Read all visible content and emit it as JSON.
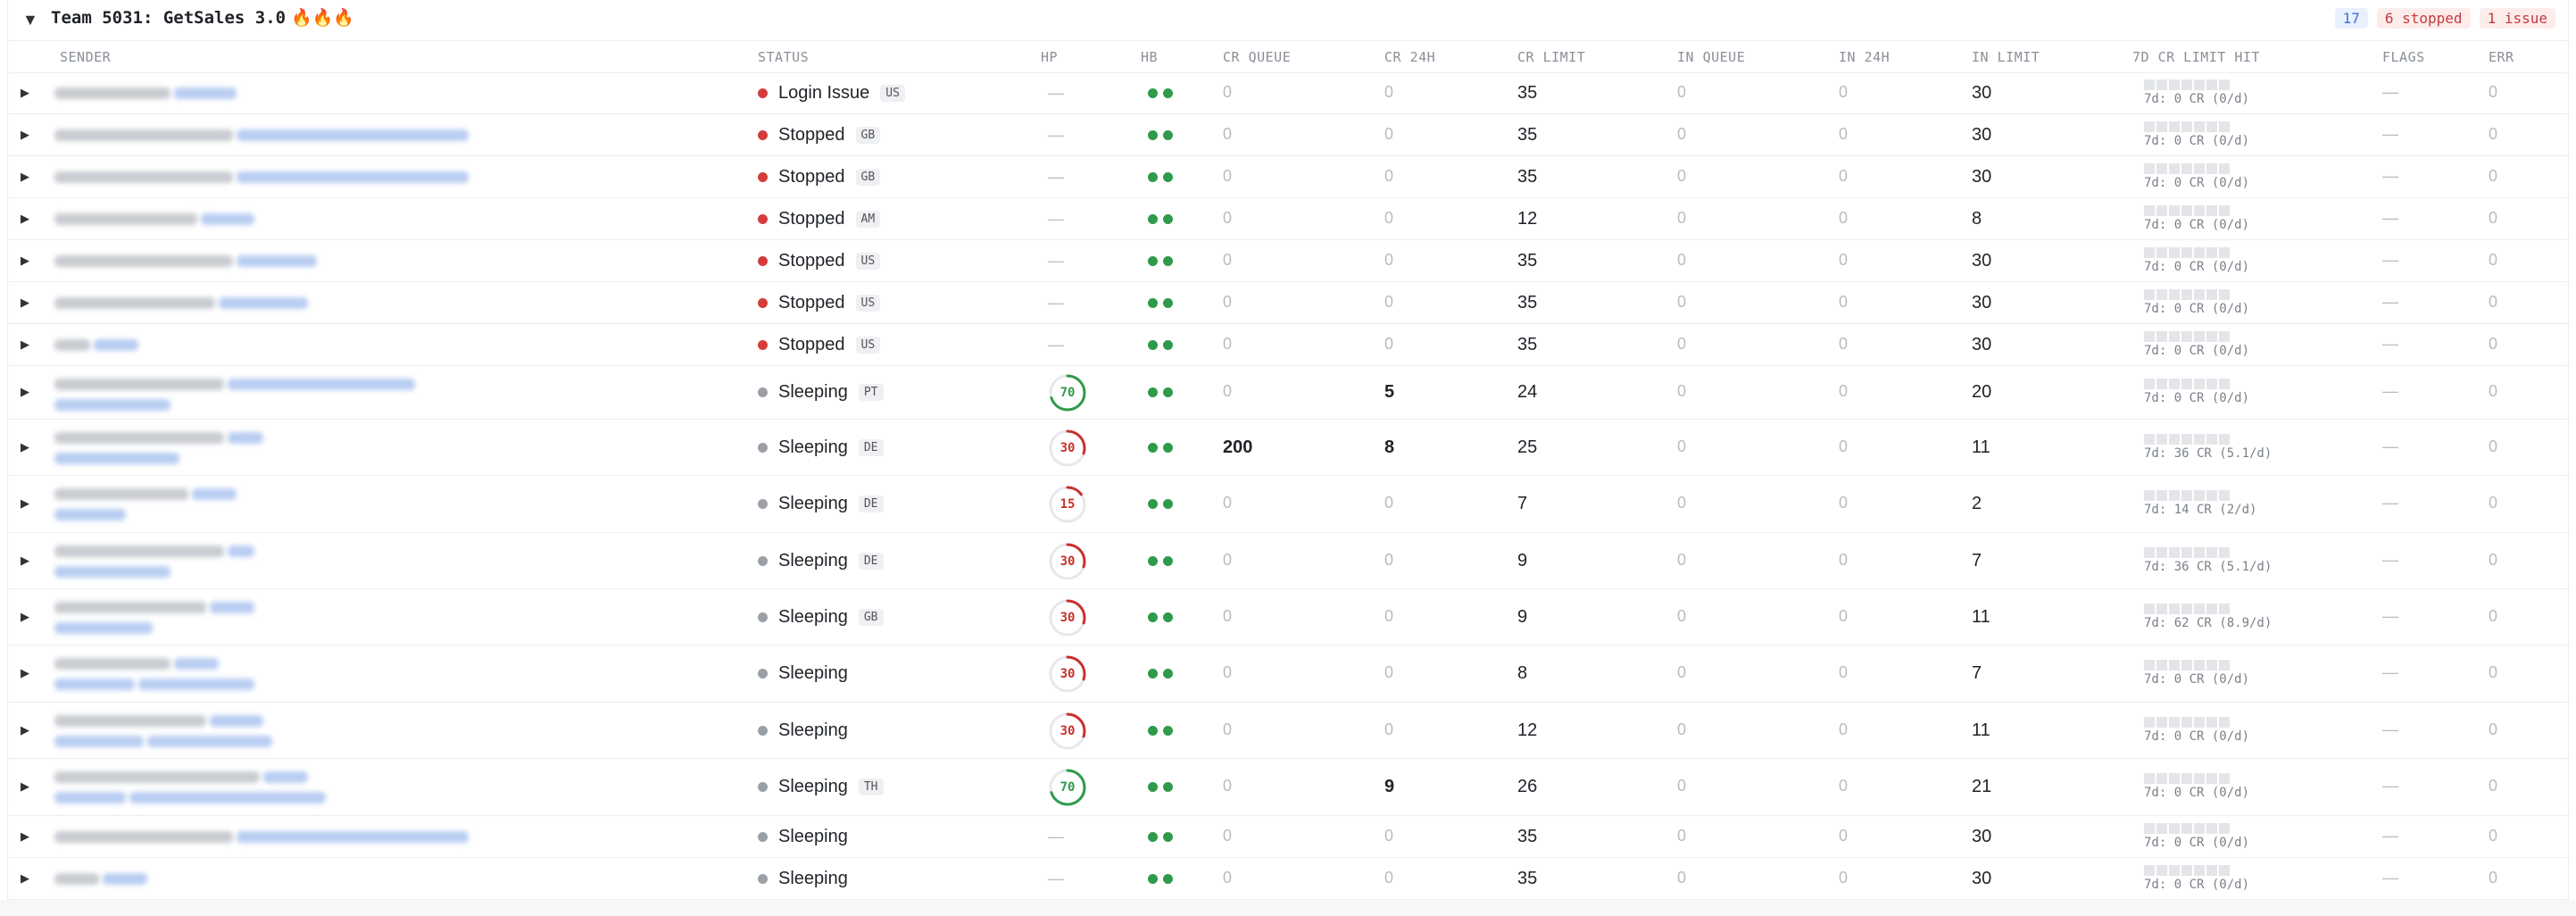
{
  "group": {
    "caret": "▼",
    "title": "Team 5031: GetSales 3.0",
    "flames": "🔥🔥🔥",
    "badge_count": "17",
    "badge_stopped": "6 stopped",
    "badge_issue": "1 issue"
  },
  "columns": {
    "sender": "SENDER",
    "status": "STATUS",
    "hp": "HP",
    "hb": "HB",
    "cr_queue": "CR QUEUE",
    "cr_24h": "CR 24H",
    "cr_limit": "CR LIMIT",
    "in_queue": "IN QUEUE",
    "in_24h": "IN 24H",
    "in_limit": "IN LIMIT",
    "hit": "7D CR LIMIT HIT",
    "flags": "FLAGS",
    "err": "ERR"
  },
  "expand_glyph": "▶",
  "dash": "—",
  "colors": {
    "status_red": "#d43c3c",
    "status_gray": "#9aa0a6",
    "hb_green": "#2f9a4a",
    "hp_red": "#c9302c",
    "hp_green": "#2f9a4a"
  },
  "rows": [
    {
      "status": "Login Issue",
      "status_color": "red",
      "country": "US",
      "hp": null,
      "cr_queue": "0",
      "cr_24h": "0",
      "cr_limit": "35",
      "in_queue": "0",
      "in_24h": "0",
      "in_limit": "30",
      "hit": "7d: 0 CR (0/d)",
      "flags": "—",
      "err": "0"
    },
    {
      "status": "Stopped",
      "status_color": "red",
      "country": "GB",
      "hp": null,
      "cr_queue": "0",
      "cr_24h": "0",
      "cr_limit": "35",
      "in_queue": "0",
      "in_24h": "0",
      "in_limit": "30",
      "hit": "7d: 0 CR (0/d)",
      "flags": "—",
      "err": "0"
    },
    {
      "status": "Stopped",
      "status_color": "red",
      "country": "GB",
      "hp": null,
      "cr_queue": "0",
      "cr_24h": "0",
      "cr_limit": "35",
      "in_queue": "0",
      "in_24h": "0",
      "in_limit": "30",
      "hit": "7d: 0 CR (0/d)",
      "flags": "—",
      "err": "0"
    },
    {
      "status": "Stopped",
      "status_color": "red",
      "country": "AM",
      "hp": null,
      "cr_queue": "0",
      "cr_24h": "0",
      "cr_limit": "12",
      "in_queue": "0",
      "in_24h": "0",
      "in_limit": "8",
      "hit": "7d: 0 CR (0/d)",
      "flags": "—",
      "err": "0"
    },
    {
      "status": "Stopped",
      "status_color": "red",
      "country": "US",
      "hp": null,
      "cr_queue": "0",
      "cr_24h": "0",
      "cr_limit": "35",
      "in_queue": "0",
      "in_24h": "0",
      "in_limit": "30",
      "hit": "7d: 0 CR (0/d)",
      "flags": "—",
      "err": "0"
    },
    {
      "status": "Stopped",
      "status_color": "red",
      "country": "US",
      "hp": null,
      "cr_queue": "0",
      "cr_24h": "0",
      "cr_limit": "35",
      "in_queue": "0",
      "in_24h": "0",
      "in_limit": "30",
      "hit": "7d: 0 CR (0/d)",
      "flags": "—",
      "err": "0"
    },
    {
      "status": "Stopped",
      "status_color": "red",
      "country": "US",
      "hp": null,
      "cr_queue": "0",
      "cr_24h": "0",
      "cr_limit": "35",
      "in_queue": "0",
      "in_24h": "0",
      "in_limit": "30",
      "hit": "7d: 0 CR (0/d)",
      "flags": "—",
      "err": "0"
    },
    {
      "status": "Sleeping",
      "status_color": "gray",
      "country": "PT",
      "hp": "70",
      "cr_queue": "0",
      "cr_24h": "5",
      "cr_limit": "24",
      "in_queue": "0",
      "in_24h": "0",
      "in_limit": "20",
      "hit": "7d: 0 CR (0/d)",
      "flags": "—",
      "err": "0"
    },
    {
      "status": "Sleeping",
      "status_color": "gray",
      "country": "DE",
      "hp": "30",
      "cr_queue": "200",
      "cr_24h": "8",
      "cr_limit": "25",
      "in_queue": "0",
      "in_24h": "0",
      "in_limit": "11",
      "hit": "7d: 36 CR (5.1/d)",
      "flags": "—",
      "err": "0"
    },
    {
      "status": "Sleeping",
      "status_color": "gray",
      "country": "DE",
      "hp": "15",
      "cr_queue": "0",
      "cr_24h": "0",
      "cr_limit": "7",
      "in_queue": "0",
      "in_24h": "0",
      "in_limit": "2",
      "hit": "7d: 14 CR (2/d)",
      "flags": "—",
      "err": "0"
    },
    {
      "status": "Sleeping",
      "status_color": "gray",
      "country": "DE",
      "hp": "30",
      "cr_queue": "0",
      "cr_24h": "0",
      "cr_limit": "9",
      "in_queue": "0",
      "in_24h": "0",
      "in_limit": "7",
      "hit": "7d: 36 CR (5.1/d)",
      "flags": "—",
      "err": "0"
    },
    {
      "status": "Sleeping",
      "status_color": "gray",
      "country": "GB",
      "hp": "30",
      "cr_queue": "0",
      "cr_24h": "0",
      "cr_limit": "9",
      "in_queue": "0",
      "in_24h": "0",
      "in_limit": "11",
      "hit": "7d: 62 CR (8.9/d)",
      "flags": "—",
      "err": "0"
    },
    {
      "status": "Sleeping",
      "status_color": "gray",
      "country": "",
      "hp": "30",
      "cr_queue": "0",
      "cr_24h": "0",
      "cr_limit": "8",
      "in_queue": "0",
      "in_24h": "0",
      "in_limit": "7",
      "hit": "7d: 0 CR (0/d)",
      "flags": "—",
      "err": "0"
    },
    {
      "status": "Sleeping",
      "status_color": "gray",
      "country": "",
      "hp": "30",
      "cr_queue": "0",
      "cr_24h": "0",
      "cr_limit": "12",
      "in_queue": "0",
      "in_24h": "0",
      "in_limit": "11",
      "hit": "7d: 0 CR (0/d)",
      "flags": "—",
      "err": "0"
    },
    {
      "status": "Sleeping",
      "status_color": "gray",
      "country": "TH",
      "hp": "70",
      "cr_queue": "0",
      "cr_24h": "9",
      "cr_limit": "26",
      "in_queue": "0",
      "in_24h": "0",
      "in_limit": "21",
      "hit": "7d: 0 CR (0/d)",
      "flags": "—",
      "err": "0"
    },
    {
      "status": "Sleeping",
      "status_color": "gray",
      "country": "",
      "hp": null,
      "cr_queue": "0",
      "cr_24h": "0",
      "cr_limit": "35",
      "in_queue": "0",
      "in_24h": "0",
      "in_limit": "30",
      "hit": "7d: 0 CR (0/d)",
      "flags": "—",
      "err": "0"
    },
    {
      "status": "Sleeping",
      "status_color": "gray",
      "country": "",
      "hp": null,
      "cr_queue": "0",
      "cr_24h": "0",
      "cr_limit": "35",
      "in_queue": "0",
      "in_24h": "0",
      "in_limit": "30",
      "hit": "7d: 0 CR (0/d)",
      "flags": "—",
      "err": "0"
    }
  ]
}
